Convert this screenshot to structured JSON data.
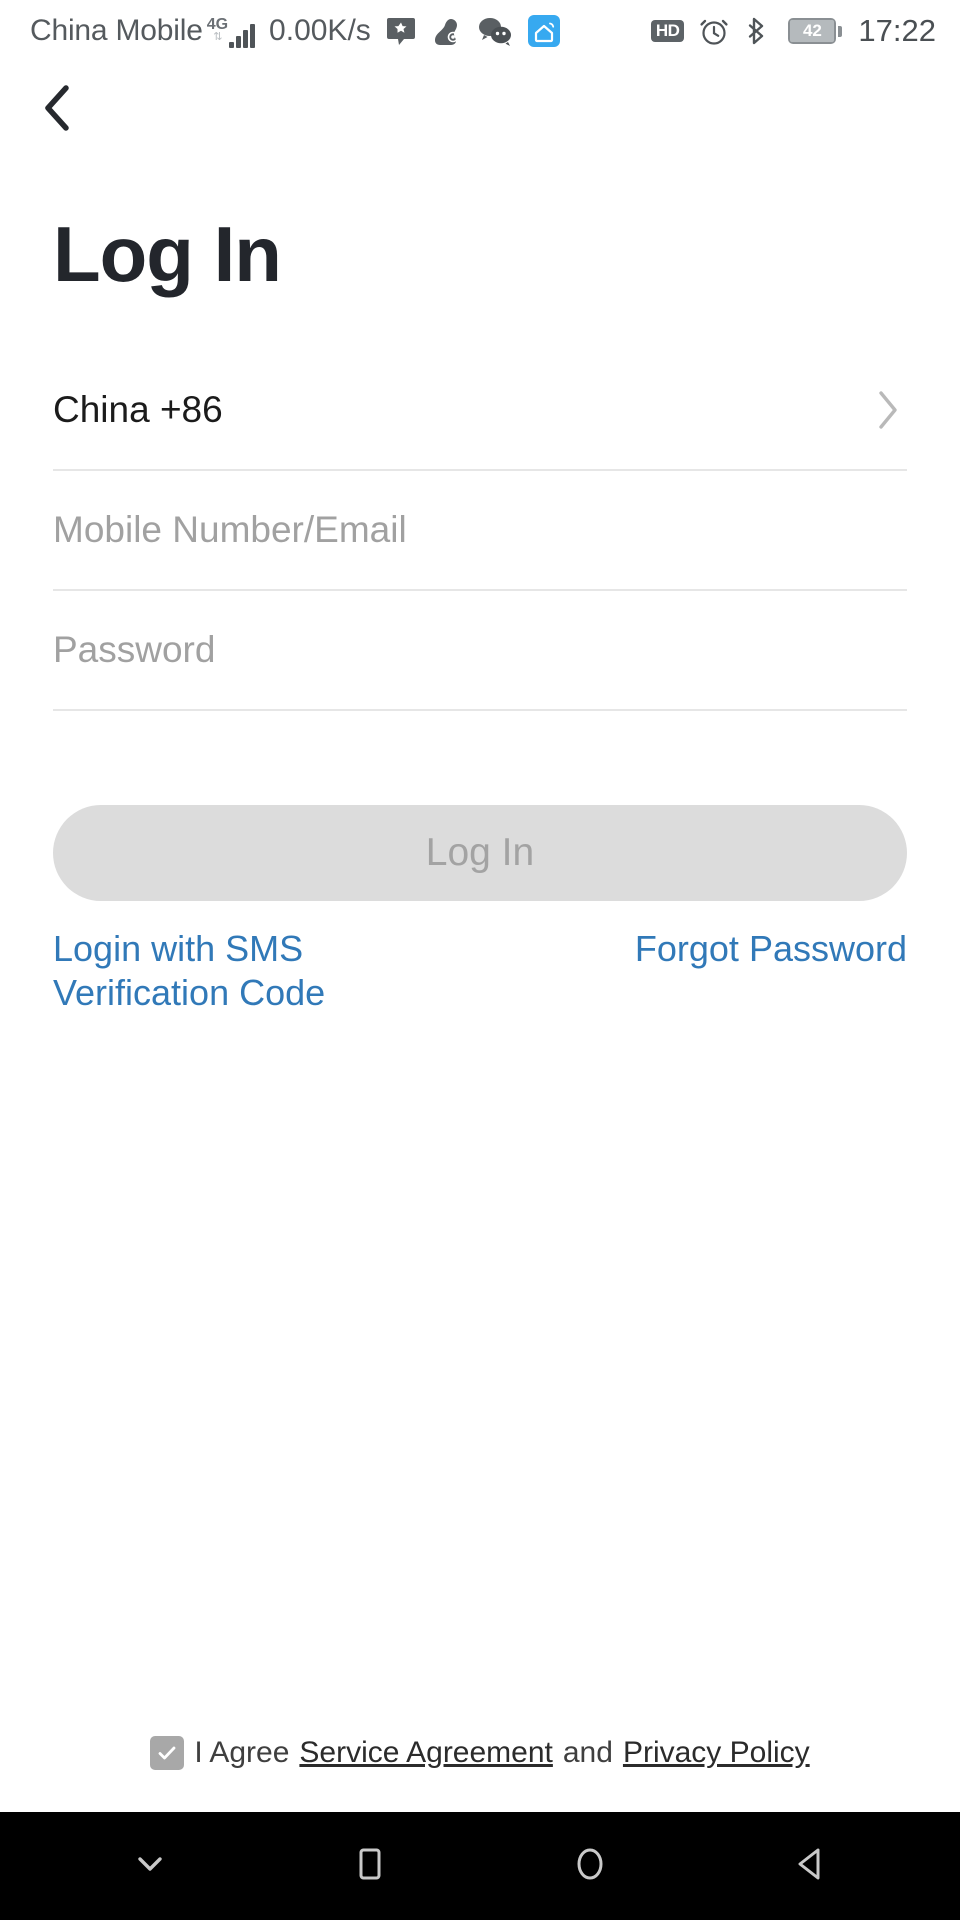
{
  "status_bar": {
    "carrier": "China Mobile",
    "network_type": "4G",
    "network_speed": "0.00K/s",
    "icons_left": [
      "message-app-icon",
      "pet-app-icon",
      "wechat-icon",
      "smart-home-icon"
    ],
    "hd_label": "HD",
    "icons_right": [
      "hd-icon",
      "alarm-clock-icon",
      "bluetooth-icon",
      "battery-icon"
    ],
    "battery_level": "42",
    "time": "17:22"
  },
  "nav": {
    "back_icon": "chevron-left-icon"
  },
  "page": {
    "title": "Log In"
  },
  "form": {
    "country": {
      "label": "China +86",
      "chevron": "chevron-right-icon"
    },
    "account": {
      "value": "",
      "placeholder": "Mobile Number/Email"
    },
    "password": {
      "value": "",
      "placeholder": "Password"
    },
    "submit_label": "Log In"
  },
  "links": {
    "sms_login": "Login with SMS Verification Code",
    "forgot_password": "Forgot Password"
  },
  "agreement": {
    "checked": true,
    "prefix": "I Agree",
    "service_agreement": "Service Agreement",
    "conjunction": "and",
    "privacy_policy": "Privacy Policy"
  },
  "system_nav": {
    "hide_keyboard": "chevron-down-icon",
    "recents": "square-icon",
    "home": "circle-icon",
    "back": "triangle-left-icon"
  },
  "colors": {
    "link_blue": "#3179b8",
    "title_dark": "#23262c",
    "placeholder_gray": "#a1a1a1",
    "button_disabled_bg": "#dcdcdc",
    "button_disabled_text": "#a3a3a3",
    "divider": "#e6e6e6"
  }
}
